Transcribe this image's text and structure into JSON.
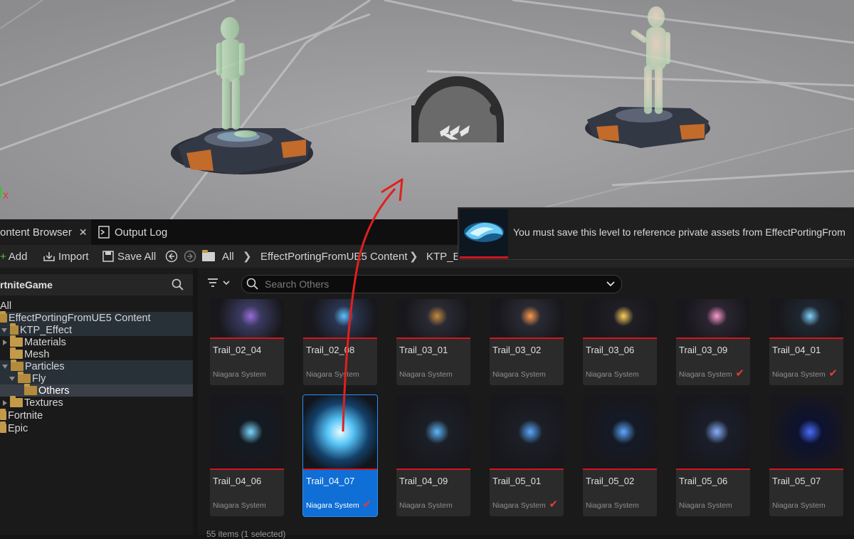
{
  "viewport": {
    "axis_label": "X"
  },
  "tabs": [
    {
      "label": "ontent Browser",
      "close": "✕"
    },
    {
      "label": "Output Log"
    }
  ],
  "toolbar": {
    "add_label": "Add",
    "import_label": "Import",
    "save_all_label": "Save All",
    "breadcrumb": [
      "All",
      "EffectPortingFromUE5 Content",
      "KTP_Ef"
    ]
  },
  "left_panel": {
    "header": "rtniteGame",
    "tree": [
      {
        "label": "All"
      },
      {
        "label": "EffectPortingFromUE5 Content"
      },
      {
        "label": "KTP_Effect"
      },
      {
        "label": "Materials"
      },
      {
        "label": "Mesh"
      },
      {
        "label": "Particles"
      },
      {
        "label": "Fly"
      },
      {
        "label": "Others"
      },
      {
        "label": "Textures"
      },
      {
        "label": "Fortnite"
      },
      {
        "label": "Epic"
      }
    ]
  },
  "search": {
    "placeholder": "Search Others"
  },
  "assets_row1": [
    {
      "name": "Trail_02_04",
      "type": "Niagara System",
      "checked": false
    },
    {
      "name": "Trail_02_08",
      "type": "Niagara System",
      "checked": false
    },
    {
      "name": "Trail_03_01",
      "type": "Niagara System",
      "checked": false
    },
    {
      "name": "Trail_03_02",
      "type": "Niagara System",
      "checked": false
    },
    {
      "name": "Trail_03_06",
      "type": "Niagara System",
      "checked": false
    },
    {
      "name": "Trail_03_09",
      "type": "Niagara System",
      "checked": true
    },
    {
      "name": "Trail_04_01",
      "type": "Niagara System",
      "checked": true
    }
  ],
  "assets_row2": [
    {
      "name": "Trail_04_06",
      "type": "Niagara System",
      "checked": false
    },
    {
      "name": "Trail_04_07",
      "type": "Niagara System",
      "checked": true,
      "selected": true
    },
    {
      "name": "Trail_04_09",
      "type": "Niagara System",
      "checked": false
    },
    {
      "name": "Trail_05_01",
      "type": "Niagara System",
      "checked": true
    },
    {
      "name": "Trail_05_02",
      "type": "Niagara System",
      "checked": false
    },
    {
      "name": "Trail_05_06",
      "type": "Niagara System",
      "checked": false
    },
    {
      "name": "Trail_05_07",
      "type": "Niagara System",
      "checked": false
    }
  ],
  "status": "55 items (1 selected)",
  "notification": {
    "message": "You must save this level to reference private assets from EffectPortingFrom"
  },
  "colors": {
    "accent": "#0f6fd6",
    "error_line": "#d3151b",
    "annotation": "#e0201e"
  }
}
